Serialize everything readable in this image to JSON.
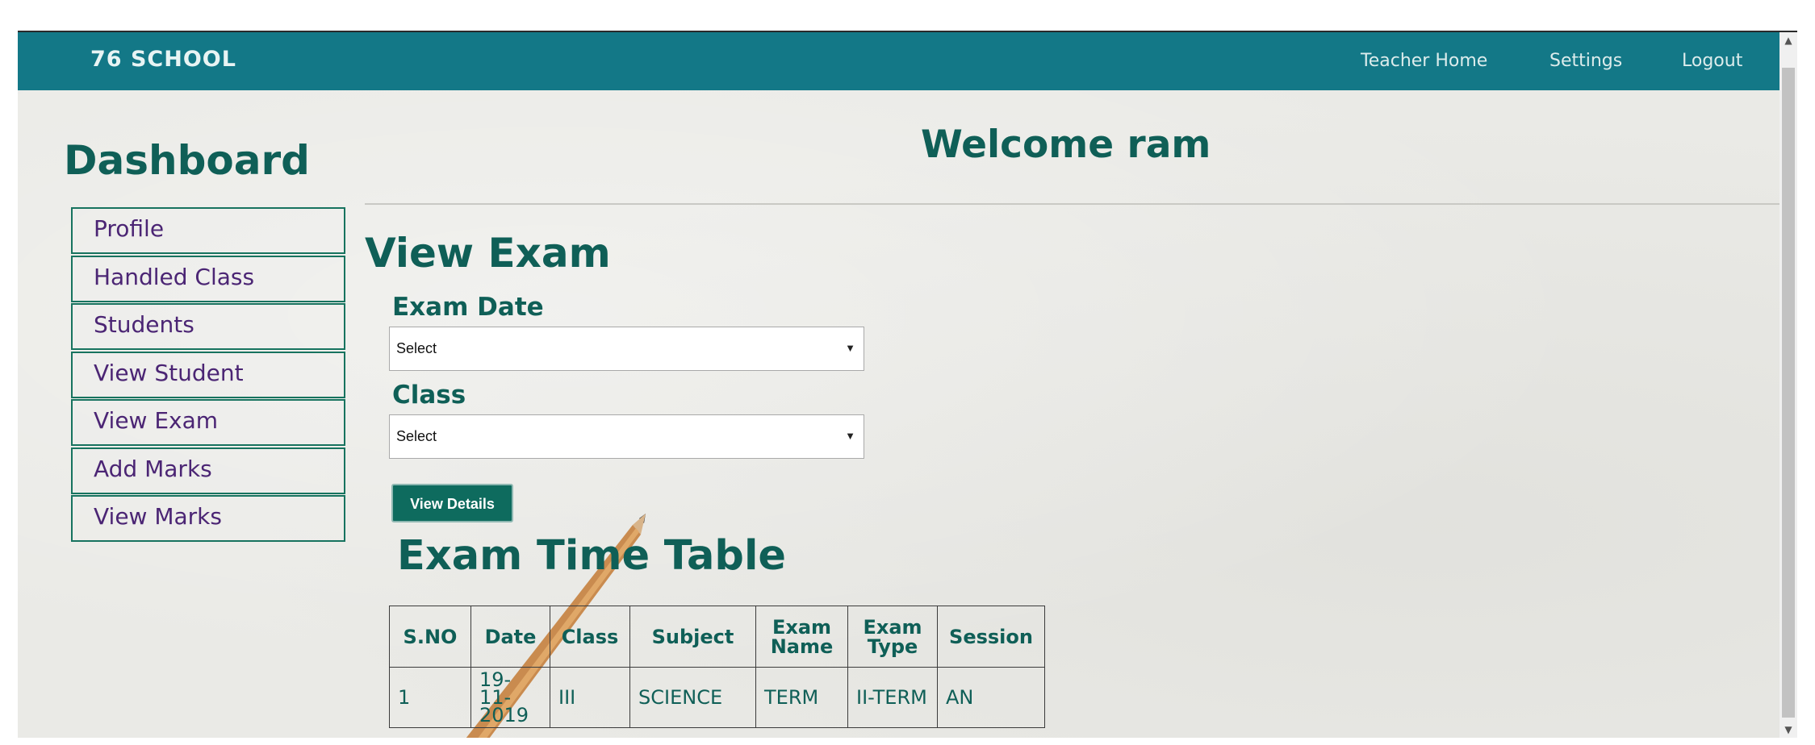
{
  "navbar": {
    "brand": "76 SCHOOL",
    "links": [
      "Teacher Home",
      "Settings",
      "Logout"
    ]
  },
  "sidebar": {
    "title": "Dashboard",
    "items": [
      "Profile",
      "Handled Class",
      "Students",
      "View Student",
      "View Exam",
      "Add Marks",
      "View Marks"
    ]
  },
  "main": {
    "welcome": "Welcome ram",
    "title": "View Exam",
    "exam_date": {
      "label": "Exam Date",
      "value": "Select"
    },
    "class": {
      "label": "Class",
      "value": "Select"
    },
    "button": "View Details",
    "timetable": {
      "title": "Exam Time Table",
      "headers": [
        "S.NO",
        "Date",
        "Class",
        "Subject",
        "Exam Name",
        "Exam Type",
        "Session"
      ],
      "rows": [
        [
          "1",
          "19-11-2019",
          "III",
          "SCIENCE",
          "TERM",
          "II-TERM",
          "AN"
        ]
      ]
    }
  },
  "scrollbar": {
    "up": "▲",
    "down": "▼"
  },
  "colors": {
    "navbar": "#137887",
    "heading": "#0f5f57",
    "menu_text": "#4b2574",
    "button": "#0e6b5e"
  }
}
